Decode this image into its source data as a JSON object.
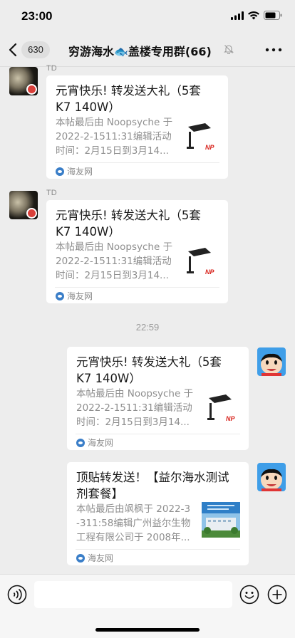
{
  "status_bar": {
    "time": "23:00"
  },
  "nav": {
    "back_count": "630",
    "title": "穷游海水🐟盖楼专用群(66)"
  },
  "messages": [
    {
      "sender": "TD",
      "title": "元宵快乐! 转发送大礼（5套\nK7  140W）",
      "desc": [
        "本帖最后由 Noopsyche 于",
        "2022-2-1511:31编辑活动",
        "时间：2月15日到3月14..."
      ],
      "thumb_text": "NP",
      "source": "海友网"
    },
    {
      "sender": "TD",
      "title": "元宵快乐! 转发送大礼（5套\nK7  140W）",
      "desc": [
        "本帖最后由 Noopsyche 于",
        "2022-2-1511:31编辑活动",
        "时间：2月15日到3月14..."
      ],
      "thumb_text": "NP",
      "source": "海友网"
    },
    {
      "title": "元宵快乐! 转发送大礼（5套\nK7  140W）",
      "desc": [
        "本帖最后由 Noopsyche 于",
        "2022-2-1511:31编辑活动",
        "时间：2月15日到3月14..."
      ],
      "thumb_text": "NP",
      "source": "海友网"
    },
    {
      "title": "顶贴转发送！【益尔海水测试\n剂套餐】",
      "desc": [
        "本帖最后由飒枫于 2022-3",
        "-311:58编辑广州益尔生物",
        "工程有限公司于 2008年..."
      ],
      "source": "海友网"
    }
  ],
  "timestamp": "22:59",
  "input": {
    "placeholder": ""
  },
  "colors": {
    "background": "#ededed",
    "card": "#ffffff",
    "muted_text": "#8e8e8e",
    "thumb_brand": "#d8231c"
  }
}
